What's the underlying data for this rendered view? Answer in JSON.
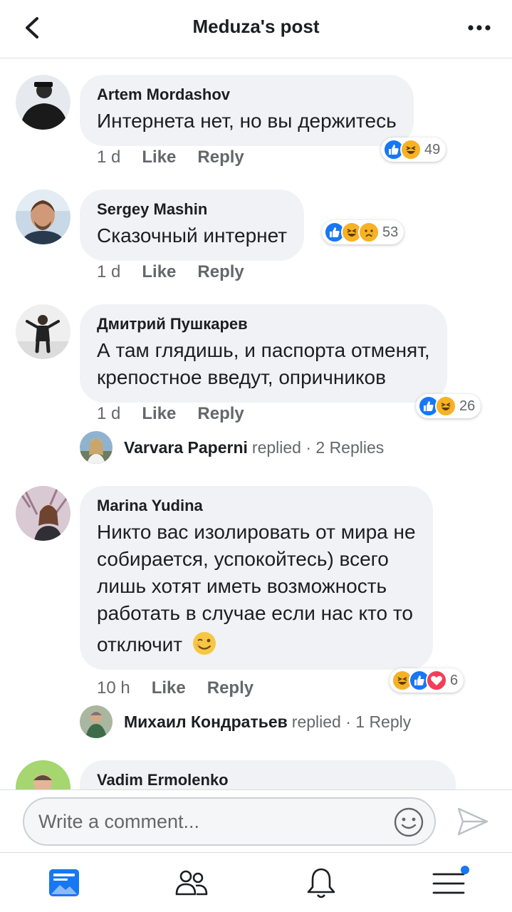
{
  "header": {
    "title": "Meduza's post"
  },
  "colors": {
    "accent": "#1877f2",
    "bubble": "#f0f2f5",
    "meta": "#65676b",
    "love": "#f33e58",
    "haha": "#f7b125"
  },
  "actions": {
    "like": "Like",
    "reply": "Reply"
  },
  "comments": [
    {
      "author": "Artem Mordashov",
      "lines": [
        "Интернета нет, но вы держитесь"
      ],
      "time": "1 d",
      "reactions": {
        "icons": [
          "like",
          "haha"
        ],
        "count": "49"
      }
    },
    {
      "author": "Sergey Mashin",
      "lines": [
        "Сказочный интернет"
      ],
      "time": "1 d",
      "reactions": {
        "icons": [
          "like",
          "haha",
          "sad"
        ],
        "count": "53"
      }
    },
    {
      "author": "Дмитрий Пушкарев",
      "lines": [
        "А там глядишь, и паспорта отменят,",
        "крепостное введут, опричников"
      ],
      "time": "1 d",
      "reactions": {
        "icons": [
          "like",
          "haha"
        ],
        "count": "26"
      },
      "replies": {
        "name": "Varvara Paperni",
        "text": "replied · 2 Replies"
      }
    },
    {
      "author": "Marina Yudina",
      "lines": [
        "Никто вас изолировать от мира не",
        "собирается, успокойтесь) всего",
        "лишь хотят иметь возможность",
        "работать в случае если нас кто то",
        "отключит"
      ],
      "emoji": "winking-face",
      "time": "10 h",
      "reactions": {
        "icons": [
          "haha",
          "like",
          "love"
        ],
        "count": "6"
      },
      "replies": {
        "name": "Михаил Кондратьев",
        "text": "replied · 1 Reply"
      }
    },
    {
      "author": "Vadim Ermolenko"
    }
  ],
  "composer": {
    "placeholder": "Write a comment..."
  },
  "tabbar": {
    "icons": [
      "news-feed-icon",
      "friends-icon",
      "notifications-icon",
      "menu-icon"
    ]
  }
}
